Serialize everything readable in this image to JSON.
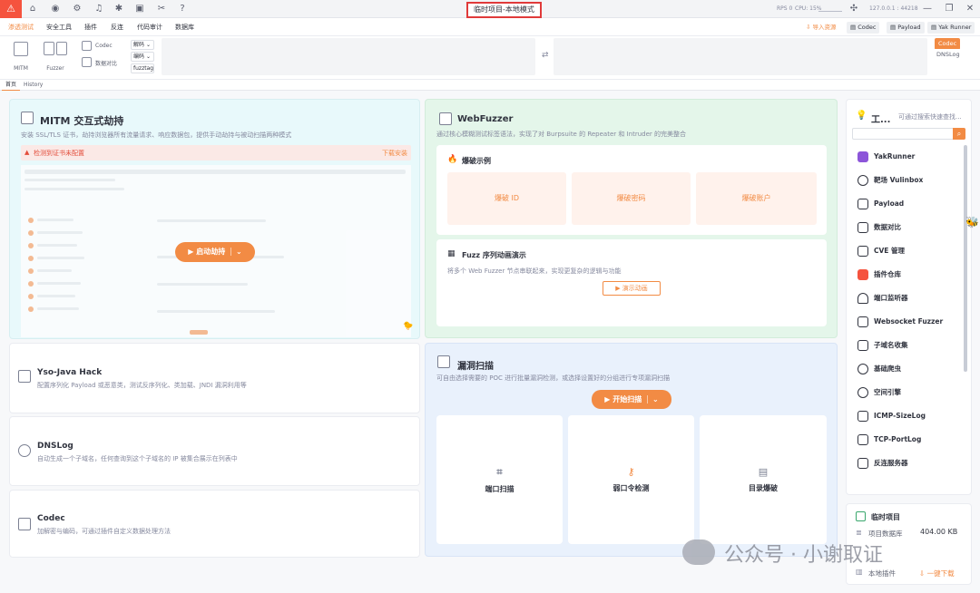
{
  "header": {
    "project_title": "临时项目-本地模式",
    "rps_label": "RPS 0",
    "cpu_label": "CPU: 15%",
    "engine_addr": "127.0.0.1 : 44218"
  },
  "menu": {
    "items": [
      "渗透测试",
      "安全工具",
      "插件",
      "反连",
      "代码审计",
      "数据库"
    ],
    "import_label": "导入资源",
    "right_tools": [
      "Codec",
      "Payload",
      "Yak Runner"
    ]
  },
  "toolbar": {
    "mitm_label": "MITM",
    "fuzzer_label": "Fuzzer",
    "codec_label": "Codec",
    "data_compare_label": "数据对比",
    "decode_label": "解码",
    "encode_label": "编码",
    "fuzztag_label": "fuzztag",
    "codec_chip": "Codec",
    "dnslog_chip": "DNSLog"
  },
  "tabs": {
    "home": "首页",
    "history": "History"
  },
  "mitm": {
    "title": "MITM 交互式劫持",
    "desc": "安装 SSL/TLS 证书，劫持浏览器所有流量请求、响应数据包，提供手动劫持与被动扫描两种模式",
    "alert": "检测到证书未配置",
    "download_label": "下载安装",
    "start_button": "启动劫持"
  },
  "webfuzzer": {
    "title": "WebFuzzer",
    "desc": "通过核心模糊测试标签语法，实现了对 Burpsuite 的 Repeater 和 Intruder 的完美整合",
    "brute_title": "爆破示例",
    "brute_items": [
      "爆破 ID",
      "爆破密码",
      "爆破账户"
    ],
    "seq_title": "Fuzz 序列动画演示",
    "seq_desc": "将多个 Web Fuzzer 节点串联起来，实现更复杂的逻辑与功能",
    "demo_button": "演示动画"
  },
  "yso": {
    "title": "Yso-Java Hack",
    "desc": "配置序列化 Payload 或恶意类，测试反序列化、类加载、JNDI 漏洞利用等"
  },
  "dnslog": {
    "title": "DNSLog",
    "desc": "自动生成一个子域名，任何查询到这个子域名的 IP 被集合展示在列表中"
  },
  "codec": {
    "title": "Codec",
    "desc": "加解密与编码，可通过插件自定义数据处理方法"
  },
  "vulnscan": {
    "title": "漏洞扫描",
    "desc": "可自由选择需要的 POC 进行批量漏洞检测，或选择设置好的分组进行专项漏洞扫描",
    "start_button": "开始扫描",
    "tiles": [
      "端口扫描",
      "弱口令检测",
      "目录爆破"
    ]
  },
  "sidebar": {
    "title": "工...",
    "search_placeholder": "可通过搜索快速查找...",
    "items": [
      "YakRunner",
      "靶场 Vulinbox",
      "Payload",
      "数据对比",
      "CVE 管理",
      "插件仓库",
      "端口监听器",
      "Websocket Fuzzer",
      "子域名收集",
      "基础爬虫",
      "空间引擎",
      "ICMP-SizeLog",
      "TCP-PortLog",
      "反连服务器"
    ]
  },
  "project": {
    "title": "临时项目",
    "db_label": "项目数据库",
    "db_size": "404.00 KB",
    "local_plugins_label": "本地插件",
    "download_label": "一键下载"
  },
  "watermark": "公众号 · 小谢取证",
  "colors": {
    "accent": "#f28b44",
    "danger": "#f5533e",
    "mitm_bg": "#e8f9fb",
    "fuzzer_bg": "#e4f6ea",
    "scan_bg": "#e9f1fc"
  }
}
